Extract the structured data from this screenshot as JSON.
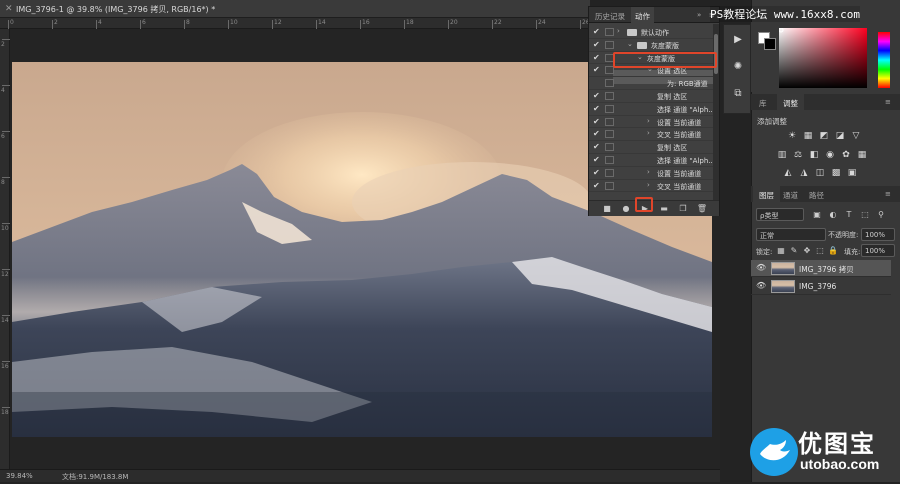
{
  "document": {
    "tab_title": "IMG_3796-1 @ 39.8% (IMG_3796 拷贝, RGB/16*) *"
  },
  "ruler": {
    "top_numbers": [
      "0",
      "2",
      "4",
      "6",
      "8",
      "10",
      "12",
      "14",
      "16",
      "18",
      "20",
      "22",
      "24",
      "26",
      "28",
      "30"
    ],
    "left_numbers": [
      "2",
      "4",
      "6",
      "8",
      "10",
      "12",
      "14",
      "16",
      "18"
    ]
  },
  "status": {
    "zoom": "39.84%",
    "doc_size": "文档:91.9M/183.8M"
  },
  "actions_panel": {
    "tabs": [
      "历史记录",
      "动作"
    ],
    "active_tab": "动作",
    "rows": [
      {
        "checked": true,
        "dialog": true,
        "indent": 0,
        "folder": true,
        "expand": ">",
        "label": "默认动作"
      },
      {
        "checked": true,
        "dialog": false,
        "indent": 1,
        "folder": true,
        "expand": "v",
        "label": "灰度蒙版"
      },
      {
        "checked": true,
        "dialog": false,
        "indent": 2,
        "folder": false,
        "expand": "v",
        "label": "灰度蒙版"
      },
      {
        "checked": true,
        "dialog": false,
        "indent": 3,
        "folder": false,
        "expand": "v",
        "label": "设置 选区"
      },
      {
        "checked": false,
        "dialog": false,
        "indent": 4,
        "folder": false,
        "expand": "",
        "label": "为: RGB通道"
      },
      {
        "checked": true,
        "dialog": false,
        "indent": 3,
        "folder": false,
        "expand": "",
        "label": "复制 选区"
      },
      {
        "checked": true,
        "dialog": false,
        "indent": 3,
        "folder": false,
        "expand": "",
        "label": "选择 通道 \"Alph..."
      },
      {
        "checked": true,
        "dialog": false,
        "indent": 3,
        "folder": false,
        "expand": ">",
        "label": "设置 当前通道"
      },
      {
        "checked": true,
        "dialog": false,
        "indent": 3,
        "folder": false,
        "expand": ">",
        "label": "交叉 当前通道"
      },
      {
        "checked": true,
        "dialog": false,
        "indent": 3,
        "folder": false,
        "expand": "",
        "label": "复制 选区"
      },
      {
        "checked": true,
        "dialog": false,
        "indent": 3,
        "folder": false,
        "expand": "",
        "label": "选择 通道 \"Alph..."
      },
      {
        "checked": true,
        "dialog": false,
        "indent": 3,
        "folder": false,
        "expand": ">",
        "label": "设置 当前通道"
      },
      {
        "checked": true,
        "dialog": false,
        "indent": 3,
        "folder": false,
        "expand": ">",
        "label": "交叉 当前通道"
      }
    ],
    "toolbar": {
      "stop": "■",
      "record": "●",
      "play": "▶",
      "new_set": "▬",
      "new_action": "❐",
      "delete": "🗑"
    }
  },
  "tool_strip": {
    "icons": [
      "▶",
      "✺",
      "⧉"
    ]
  },
  "right_dock": {
    "adjust_tabs": [
      "库",
      "调整"
    ],
    "adjust_active": "调整",
    "adjust_title": "添加调整",
    "adjust_icons_row1": [
      "☀",
      "▦",
      "◩",
      "◪",
      "▽"
    ],
    "adjust_icons_row2": [
      "▥",
      "⚖",
      "◧",
      "◉",
      "✿",
      "▦"
    ],
    "adjust_icons_row3": [
      "◭",
      "◮",
      "◫",
      "▩",
      "▣"
    ],
    "layers_tabs": [
      "图层",
      "通道",
      "路径"
    ],
    "layers_active": "图层",
    "filter_label": "ρ类型",
    "filter_icons": [
      "▣",
      "◐",
      "T",
      "⬚",
      "⚲"
    ],
    "blend_mode": "正常",
    "opacity_label": "不透明度:",
    "opacity_value": "100%",
    "lock_label": "锁定:",
    "lock_icons": [
      "▦",
      "✎",
      "✥",
      "⬚",
      "🔒"
    ],
    "fill_label": "填充:",
    "fill_value": "100%",
    "layers": [
      {
        "name": "IMG_3796 拷贝",
        "selected": true
      },
      {
        "name": "IMG_3796",
        "selected": false
      }
    ]
  },
  "watermark": {
    "top_text": "PS教程论坛 www.16xx8.com",
    "logo_cn": "优图宝",
    "logo_en": "utobao.com"
  },
  "colors": {
    "highlight": "#e0452a",
    "panel_bg": "#404040",
    "dock_bg": "#383838"
  }
}
